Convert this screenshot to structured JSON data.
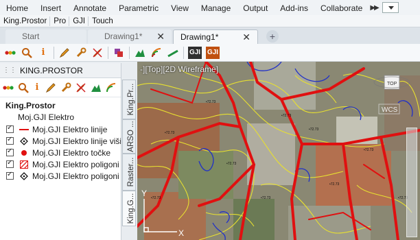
{
  "ribbon": {
    "tabs": [
      "Home",
      "Insert",
      "Annotate",
      "Parametric",
      "View",
      "Manage",
      "Output",
      "Add-ins",
      "Collaborate"
    ]
  },
  "subtabs": [
    "King.Prostor",
    "Pro",
    "GJI",
    "Touch"
  ],
  "file_tabs": {
    "start": "Start",
    "drawing_inactive": "Drawing1*",
    "drawing_active": "Drawing1*",
    "close_glyph": "✕",
    "new_glyph": "+"
  },
  "toolbar": {
    "icons": [
      "traffic-lights-icon",
      "search-icon",
      "info-icon",
      "pencil-icon",
      "wrench-icon",
      "no-edit-icon",
      "layers-icon",
      "terrain-icon",
      "signal-icon",
      "slope-icon",
      "gji-icon",
      "gji-edit-icon"
    ],
    "gji_label": "GJI"
  },
  "panel": {
    "title": "KING.PROSTOR",
    "tree": {
      "root": "King.Prostor",
      "group": "Moj.GJI Elektro",
      "items": [
        {
          "label": "Moj.GJI Elektro linije"
        },
        {
          "label": "Moj.GJI Elektro linije višine"
        },
        {
          "label": "Moj.GJI Elektro točke"
        },
        {
          "label": "Moj.GJI Elektro poligoni"
        },
        {
          "label": "Moj.GJI Elektro poligoni višine"
        }
      ]
    },
    "side_tabs": [
      "King.Pr...",
      "ARSO ...",
      "Raster...",
      "King.G..."
    ]
  },
  "viewport": {
    "label": "-][Top][2D Wireframe]",
    "wcs": "WCS",
    "top_label": "TOP",
    "y_axis": "Y",
    "x_axis": "X"
  },
  "colors": {
    "accent_red": "#e01010",
    "contour_yellow": "#e8e030",
    "contour_blue": "#2030c8"
  }
}
